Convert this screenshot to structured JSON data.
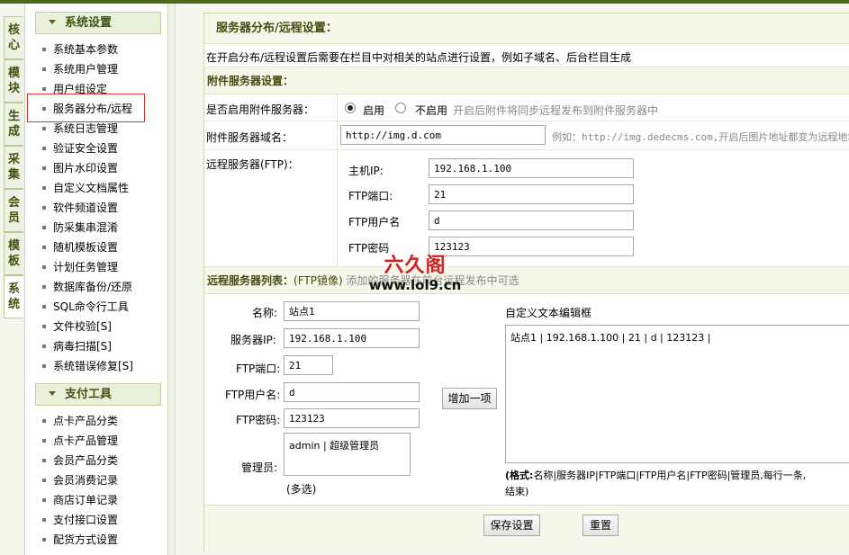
{
  "sidebar_tabs": [
    "核心",
    "模块",
    "生成",
    "采集",
    "会员",
    "模板",
    "系统"
  ],
  "menu": {
    "group1_title": "系统设置",
    "group1_items": [
      "系统基本参数",
      "系统用户管理",
      "用户组设定",
      "服务器分布/远程",
      "系统日志管理",
      "验证安全设置",
      "图片水印设置",
      "自定义文档属性",
      "软件频道设置",
      "防采集串混淆",
      "随机模板设置",
      "计划任务管理",
      "数据库备份/还原",
      "SQL命令行工具",
      "文件校验[S]",
      "病毒扫描[S]",
      "系统错误修复[S]"
    ],
    "group2_title": "支付工具",
    "group2_items": [
      "点卡产品分类",
      "点卡产品管理",
      "会员产品分类",
      "会员消费记录",
      "商店订单记录",
      "支付接口设置",
      "配货方式设置"
    ]
  },
  "page": {
    "title": "服务器分布/远程设置：",
    "intro": "在开启分布/远程设置后需要在栏目中对相关的站点进行设置，例如子域名、后台栏目生成",
    "attach_section": "附件服务器设置：",
    "enable_label": "是否启用附件服务器：",
    "enable_on": "启用",
    "enable_off": "不启用",
    "enable_hint": "开启后附件将同步远程发布到附件服务器中",
    "domain_label": "附件服务器域名：",
    "domain_value": "http://img.d.com",
    "domain_hint": "例如：http://img.dedecms.com,开启后图片地址都变为远程地址",
    "ftp_label": "远程服务器(FTP)：",
    "ftp_host_label": "主机IP:",
    "ftp_host_value": "192.168.1.100",
    "ftp_port_label": "FTP端口:",
    "ftp_port_value": "21",
    "ftp_user_label": "FTP用户名",
    "ftp_user_value": "d",
    "ftp_pwd_label": "FTP密码",
    "ftp_pwd_value": "123123",
    "list_section": "远程服务器列表：",
    "list_mirror": "(FTP镜像)",
    "list_hint": "添加的服务器在前台远程发布中可选",
    "name_label": "名称:",
    "name_value": "站点1",
    "server_ip_label": "服务器IP:",
    "server_ip_value": "192.168.1.100",
    "port_label": "FTP端口:",
    "port_value": "21",
    "user_label": "FTP用户名:",
    "user_value": "d",
    "pwd_label": "FTP密码:",
    "pwd_value": "123123",
    "admin_label": "管理员:",
    "admin_option": "admin | 超级管理员",
    "multi_hint": "(多选)",
    "add_button": "增加一项",
    "custom_label": "自定义文本编辑框",
    "custom_text": "站点1 | 192.168.1.100 | 21 | d | 123123 |",
    "format_note_bold": "(格式:",
    "format_note": "名称|服务器IP|FTP端口|FTP用户名|FTP密码|管理员,每行一条,",
    "format_end": "结束)",
    "save_button": "保存设置",
    "reset_button": "重置"
  },
  "watermark": {
    "text1": "六久阁",
    "text2": "www.lol9.cn"
  },
  "colors": {
    "accent": "#4e6a18",
    "highlight": "#d23b32",
    "watermark": "#d21f1f"
  }
}
